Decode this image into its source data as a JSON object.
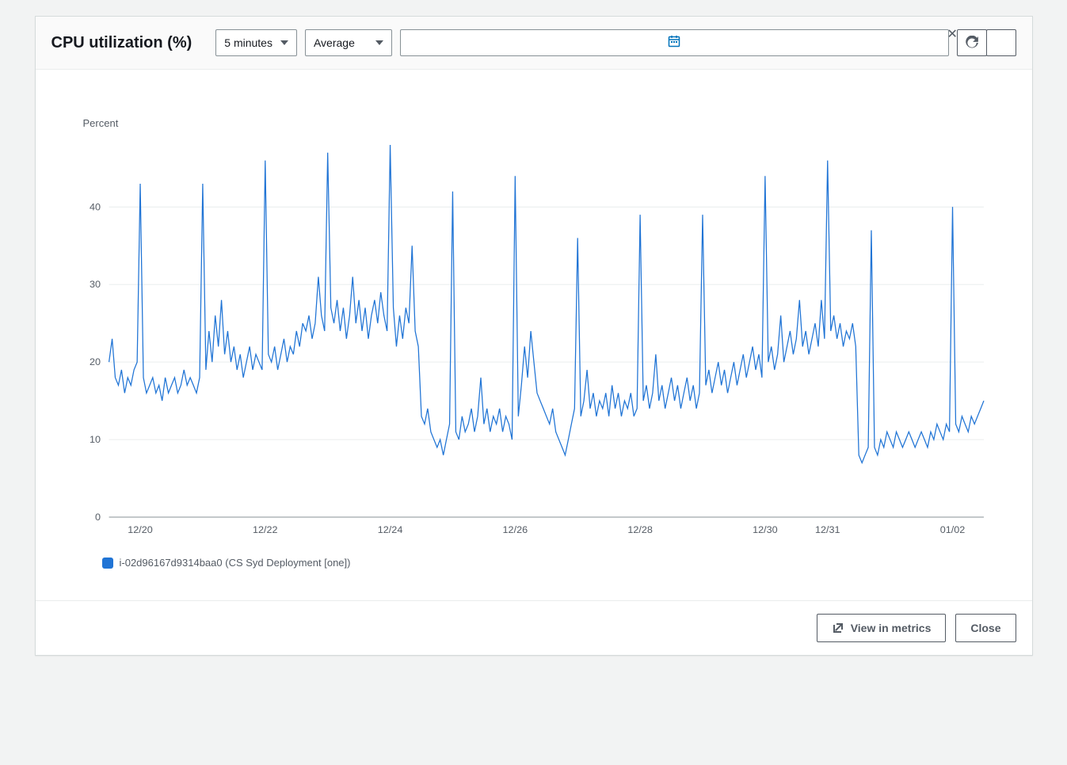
{
  "header": {
    "title": "CPU utilization (%)",
    "period_label": "5 minutes",
    "statistic_label": "Average"
  },
  "buttons": {
    "view_in_metrics": "View in metrics",
    "close": "Close"
  },
  "legend": {
    "series_label": "i-02d96167d9314baa0 (CS Syd Deployment [one])"
  },
  "chart_data": {
    "type": "line",
    "title": "CPU utilization (%)",
    "ylabel": "Percent",
    "xlabel": "",
    "ylim": [
      0,
      48
    ],
    "y_ticks": [
      0,
      10,
      20,
      30,
      40
    ],
    "x_tick_labels": [
      "12/20",
      "12/22",
      "12/24",
      "12/26",
      "12/28",
      "12/30",
      "12/31",
      "01/02"
    ],
    "x_tick_positions": [
      0.5,
      2.5,
      4.5,
      6.5,
      8.5,
      10.5,
      11.5,
      13.5
    ],
    "x_range": [
      0,
      14
    ],
    "series": [
      {
        "name": "i-02d96167d9314baa0 (CS Syd Deployment [one])",
        "color": "#2074d5",
        "values": [
          [
            0.0,
            20
          ],
          [
            0.05,
            23
          ],
          [
            0.1,
            18
          ],
          [
            0.15,
            17
          ],
          [
            0.2,
            19
          ],
          [
            0.25,
            16
          ],
          [
            0.3,
            18
          ],
          [
            0.35,
            17
          ],
          [
            0.4,
            19
          ],
          [
            0.45,
            20
          ],
          [
            0.5,
            43
          ],
          [
            0.55,
            18
          ],
          [
            0.6,
            16
          ],
          [
            0.65,
            17
          ],
          [
            0.7,
            18
          ],
          [
            0.75,
            16
          ],
          [
            0.8,
            17
          ],
          [
            0.85,
            15
          ],
          [
            0.9,
            18
          ],
          [
            0.95,
            16
          ],
          [
            1.0,
            17
          ],
          [
            1.05,
            18
          ],
          [
            1.1,
            16
          ],
          [
            1.15,
            17
          ],
          [
            1.2,
            19
          ],
          [
            1.25,
            17
          ],
          [
            1.3,
            18
          ],
          [
            1.35,
            17
          ],
          [
            1.4,
            16
          ],
          [
            1.45,
            18
          ],
          [
            1.5,
            43
          ],
          [
            1.55,
            19
          ],
          [
            1.6,
            24
          ],
          [
            1.65,
            20
          ],
          [
            1.7,
            26
          ],
          [
            1.75,
            22
          ],
          [
            1.8,
            28
          ],
          [
            1.85,
            21
          ],
          [
            1.9,
            24
          ],
          [
            1.95,
            20
          ],
          [
            2.0,
            22
          ],
          [
            2.05,
            19
          ],
          [
            2.1,
            21
          ],
          [
            2.15,
            18
          ],
          [
            2.2,
            20
          ],
          [
            2.25,
            22
          ],
          [
            2.3,
            19
          ],
          [
            2.35,
            21
          ],
          [
            2.4,
            20
          ],
          [
            2.45,
            19
          ],
          [
            2.5,
            46
          ],
          [
            2.55,
            21
          ],
          [
            2.6,
            20
          ],
          [
            2.65,
            22
          ],
          [
            2.7,
            19
          ],
          [
            2.75,
            21
          ],
          [
            2.8,
            23
          ],
          [
            2.85,
            20
          ],
          [
            2.9,
            22
          ],
          [
            2.95,
            21
          ],
          [
            3.0,
            24
          ],
          [
            3.05,
            22
          ],
          [
            3.1,
            25
          ],
          [
            3.15,
            24
          ],
          [
            3.2,
            26
          ],
          [
            3.25,
            23
          ],
          [
            3.3,
            25
          ],
          [
            3.35,
            31
          ],
          [
            3.4,
            26
          ],
          [
            3.45,
            24
          ],
          [
            3.5,
            47
          ],
          [
            3.55,
            27
          ],
          [
            3.6,
            25
          ],
          [
            3.65,
            28
          ],
          [
            3.7,
            24
          ],
          [
            3.75,
            27
          ],
          [
            3.8,
            23
          ],
          [
            3.85,
            26
          ],
          [
            3.9,
            31
          ],
          [
            3.95,
            25
          ],
          [
            4.0,
            28
          ],
          [
            4.05,
            24
          ],
          [
            4.1,
            27
          ],
          [
            4.15,
            23
          ],
          [
            4.2,
            26
          ],
          [
            4.25,
            28
          ],
          [
            4.3,
            25
          ],
          [
            4.35,
            29
          ],
          [
            4.4,
            26
          ],
          [
            4.45,
            24
          ],
          [
            4.5,
            48
          ],
          [
            4.55,
            27
          ],
          [
            4.6,
            22
          ],
          [
            4.65,
            26
          ],
          [
            4.7,
            23
          ],
          [
            4.75,
            27
          ],
          [
            4.8,
            25
          ],
          [
            4.85,
            35
          ],
          [
            4.9,
            24
          ],
          [
            4.95,
            22
          ],
          [
            5.0,
            13
          ],
          [
            5.05,
            12
          ],
          [
            5.1,
            14
          ],
          [
            5.15,
            11
          ],
          [
            5.2,
            10
          ],
          [
            5.25,
            9
          ],
          [
            5.3,
            10
          ],
          [
            5.35,
            8
          ],
          [
            5.4,
            10
          ],
          [
            5.45,
            12
          ],
          [
            5.5,
            42
          ],
          [
            5.55,
            11
          ],
          [
            5.6,
            10
          ],
          [
            5.65,
            13
          ],
          [
            5.7,
            11
          ],
          [
            5.75,
            12
          ],
          [
            5.8,
            14
          ],
          [
            5.85,
            11
          ],
          [
            5.9,
            13
          ],
          [
            5.95,
            18
          ],
          [
            6.0,
            12
          ],
          [
            6.05,
            14
          ],
          [
            6.1,
            11
          ],
          [
            6.15,
            13
          ],
          [
            6.2,
            12
          ],
          [
            6.25,
            14
          ],
          [
            6.3,
            11
          ],
          [
            6.35,
            13
          ],
          [
            6.4,
            12
          ],
          [
            6.45,
            10
          ],
          [
            6.5,
            44
          ],
          [
            6.55,
            13
          ],
          [
            6.6,
            17
          ],
          [
            6.65,
            22
          ],
          [
            6.7,
            18
          ],
          [
            6.75,
            24
          ],
          [
            6.8,
            20
          ],
          [
            6.85,
            16
          ],
          [
            6.9,
            15
          ],
          [
            6.95,
            14
          ],
          [
            7.0,
            13
          ],
          [
            7.05,
            12
          ],
          [
            7.1,
            14
          ],
          [
            7.15,
            11
          ],
          [
            7.2,
            10
          ],
          [
            7.25,
            9
          ],
          [
            7.3,
            8
          ],
          [
            7.35,
            10
          ],
          [
            7.4,
            12
          ],
          [
            7.45,
            14
          ],
          [
            7.5,
            36
          ],
          [
            7.55,
            13
          ],
          [
            7.6,
            15
          ],
          [
            7.65,
            19
          ],
          [
            7.7,
            14
          ],
          [
            7.75,
            16
          ],
          [
            7.8,
            13
          ],
          [
            7.85,
            15
          ],
          [
            7.9,
            14
          ],
          [
            7.95,
            16
          ],
          [
            8.0,
            13
          ],
          [
            8.05,
            17
          ],
          [
            8.1,
            14
          ],
          [
            8.15,
            16
          ],
          [
            8.2,
            13
          ],
          [
            8.25,
            15
          ],
          [
            8.3,
            14
          ],
          [
            8.35,
            16
          ],
          [
            8.4,
            13
          ],
          [
            8.45,
            14
          ],
          [
            8.5,
            39
          ],
          [
            8.55,
            15
          ],
          [
            8.6,
            17
          ],
          [
            8.65,
            14
          ],
          [
            8.7,
            16
          ],
          [
            8.75,
            21
          ],
          [
            8.8,
            15
          ],
          [
            8.85,
            17
          ],
          [
            8.9,
            14
          ],
          [
            8.95,
            16
          ],
          [
            9.0,
            18
          ],
          [
            9.05,
            15
          ],
          [
            9.1,
            17
          ],
          [
            9.15,
            14
          ],
          [
            9.2,
            16
          ],
          [
            9.25,
            18
          ],
          [
            9.3,
            15
          ],
          [
            9.35,
            17
          ],
          [
            9.4,
            14
          ],
          [
            9.45,
            16
          ],
          [
            9.5,
            39
          ],
          [
            9.55,
            17
          ],
          [
            9.6,
            19
          ],
          [
            9.65,
            16
          ],
          [
            9.7,
            18
          ],
          [
            9.75,
            20
          ],
          [
            9.8,
            17
          ],
          [
            9.85,
            19
          ],
          [
            9.9,
            16
          ],
          [
            9.95,
            18
          ],
          [
            10.0,
            20
          ],
          [
            10.05,
            17
          ],
          [
            10.1,
            19
          ],
          [
            10.15,
            21
          ],
          [
            10.2,
            18
          ],
          [
            10.25,
            20
          ],
          [
            10.3,
            22
          ],
          [
            10.35,
            19
          ],
          [
            10.4,
            21
          ],
          [
            10.45,
            18
          ],
          [
            10.5,
            44
          ],
          [
            10.55,
            20
          ],
          [
            10.6,
            22
          ],
          [
            10.65,
            19
          ],
          [
            10.7,
            21
          ],
          [
            10.75,
            26
          ],
          [
            10.8,
            20
          ],
          [
            10.85,
            22
          ],
          [
            10.9,
            24
          ],
          [
            10.95,
            21
          ],
          [
            11.0,
            23
          ],
          [
            11.05,
            28
          ],
          [
            11.1,
            22
          ],
          [
            11.15,
            24
          ],
          [
            11.2,
            21
          ],
          [
            11.25,
            23
          ],
          [
            11.3,
            25
          ],
          [
            11.35,
            22
          ],
          [
            11.4,
            28
          ],
          [
            11.45,
            23
          ],
          [
            11.5,
            46
          ],
          [
            11.55,
            24
          ],
          [
            11.6,
            26
          ],
          [
            11.65,
            23
          ],
          [
            11.7,
            25
          ],
          [
            11.75,
            22
          ],
          [
            11.8,
            24
          ],
          [
            11.85,
            23
          ],
          [
            11.9,
            25
          ],
          [
            11.95,
            22
          ],
          [
            12.0,
            8
          ],
          [
            12.05,
            7
          ],
          [
            12.1,
            8
          ],
          [
            12.15,
            9
          ],
          [
            12.2,
            37
          ],
          [
            12.25,
            9
          ],
          [
            12.3,
            8
          ],
          [
            12.35,
            10
          ],
          [
            12.4,
            9
          ],
          [
            12.45,
            11
          ],
          [
            12.5,
            10
          ],
          [
            12.55,
            9
          ],
          [
            12.6,
            11
          ],
          [
            12.65,
            10
          ],
          [
            12.7,
            9
          ],
          [
            12.75,
            10
          ],
          [
            12.8,
            11
          ],
          [
            12.85,
            10
          ],
          [
            12.9,
            9
          ],
          [
            12.95,
            10
          ],
          [
            13.0,
            11
          ],
          [
            13.05,
            10
          ],
          [
            13.1,
            9
          ],
          [
            13.15,
            11
          ],
          [
            13.2,
            10
          ],
          [
            13.25,
            12
          ],
          [
            13.3,
            11
          ],
          [
            13.35,
            10
          ],
          [
            13.4,
            12
          ],
          [
            13.45,
            11
          ],
          [
            13.5,
            40
          ],
          [
            13.55,
            12
          ],
          [
            13.6,
            11
          ],
          [
            13.65,
            13
          ],
          [
            13.7,
            12
          ],
          [
            13.75,
            11
          ],
          [
            13.8,
            13
          ],
          [
            13.85,
            12
          ],
          [
            13.9,
            13
          ],
          [
            13.95,
            14
          ],
          [
            14.0,
            15
          ]
        ]
      }
    ]
  }
}
